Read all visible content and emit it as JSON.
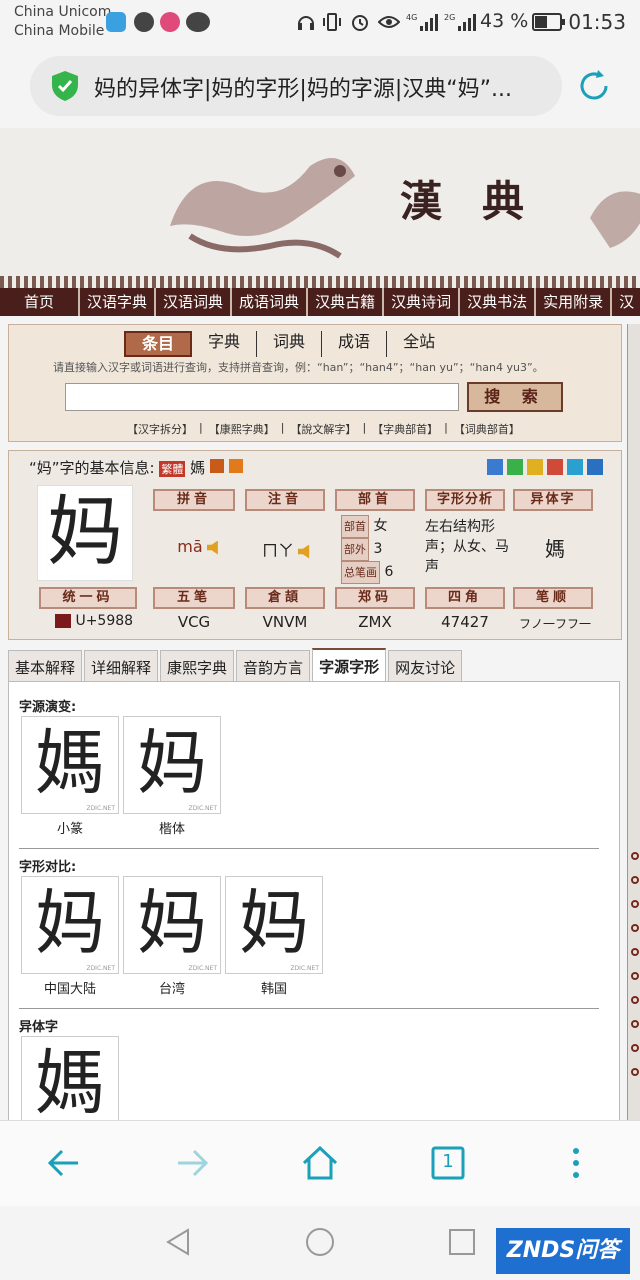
{
  "status": {
    "carrier1": "China Unicom",
    "carrier2": "China Mobile",
    "network": "4G",
    "network2": "2G",
    "battery": "43 %",
    "time": "01:53"
  },
  "browser": {
    "page_title": "妈的异体字|妈的字形|妈的字源|汉典“妈”...",
    "secure_icon": "shield-check-icon",
    "reload_icon": "reload-icon",
    "tab_count": "1"
  },
  "header": {
    "logo": "漢典"
  },
  "nav": [
    "首页",
    "汉语字典",
    "汉语词典",
    "成语词典",
    "汉典古籍",
    "汉典诗词",
    "汉典书法",
    "实用附录",
    "汉"
  ],
  "search": {
    "tabs": [
      "条目",
      "字典",
      "词典",
      "成语",
      "全站"
    ],
    "active_tab": "条目",
    "hint": "请直接输入汉字或词语进行查询，支持拼音查询，例：“han”；“han4”；“han yu”；“han4 yu3”。",
    "input_value": "",
    "button": "搜 索",
    "links": [
      "【汉字拆分】",
      "|",
      "【康熙字典】",
      "|",
      "【說文解字】",
      "|",
      "【字典部首】",
      "|",
      "【词典部首】"
    ]
  },
  "info": {
    "heading": "“妈”字的基本信息:",
    "traditional_tag": "繁體",
    "traditional_char": "媽",
    "char": "妈",
    "labels": {
      "pinyin": "拼音",
      "zhuyin": "注音",
      "radical": "部首",
      "structure": "字形分析",
      "variant": "异体字",
      "unicode": "统一码",
      "wubi": "五笔",
      "cangjie": "倉頡",
      "zhengma": "郑码",
      "sijiao": "四角",
      "bishun": "笔顺"
    },
    "pinyin": "mā",
    "zhuyin": "ㄇㄚ",
    "radical_rows": [
      {
        "tag": "部首",
        "value": "女"
      },
      {
        "tag": "部外",
        "value": "3"
      },
      {
        "tag": "总笔画",
        "value": "6"
      }
    ],
    "structure": "左右结构形声；从女、马声",
    "variant": "媽",
    "unicode": "U+5988",
    "wubi": "VCG",
    "cangjie": "VNVM",
    "zhengma": "ZMX",
    "sijiao": "47427",
    "bishun": "フノ一フフ一"
  },
  "content_tabs": [
    "基本解释",
    "详细解释",
    "康熙字典",
    "音韵方言",
    "字源字形",
    "网友讨论"
  ],
  "active_content_tab": "字源字形",
  "content": {
    "evolution_title": "字源演变:",
    "evolution": [
      {
        "glyph": "媽",
        "caption": "小篆"
      },
      {
        "glyph": "妈",
        "caption": "楷体"
      }
    ],
    "compare_title": "字形对比:",
    "compare": [
      {
        "glyph": "妈",
        "caption": "中国大陆"
      },
      {
        "glyph": "妈",
        "caption": "台湾"
      },
      {
        "glyph": "妈",
        "caption": "韩国"
      }
    ],
    "variant_title": "异体字",
    "variants": [
      {
        "glyph": "媽"
      }
    ],
    "watermark": "ZDIC.NET"
  },
  "watermark_brand": "ZNDS问答"
}
